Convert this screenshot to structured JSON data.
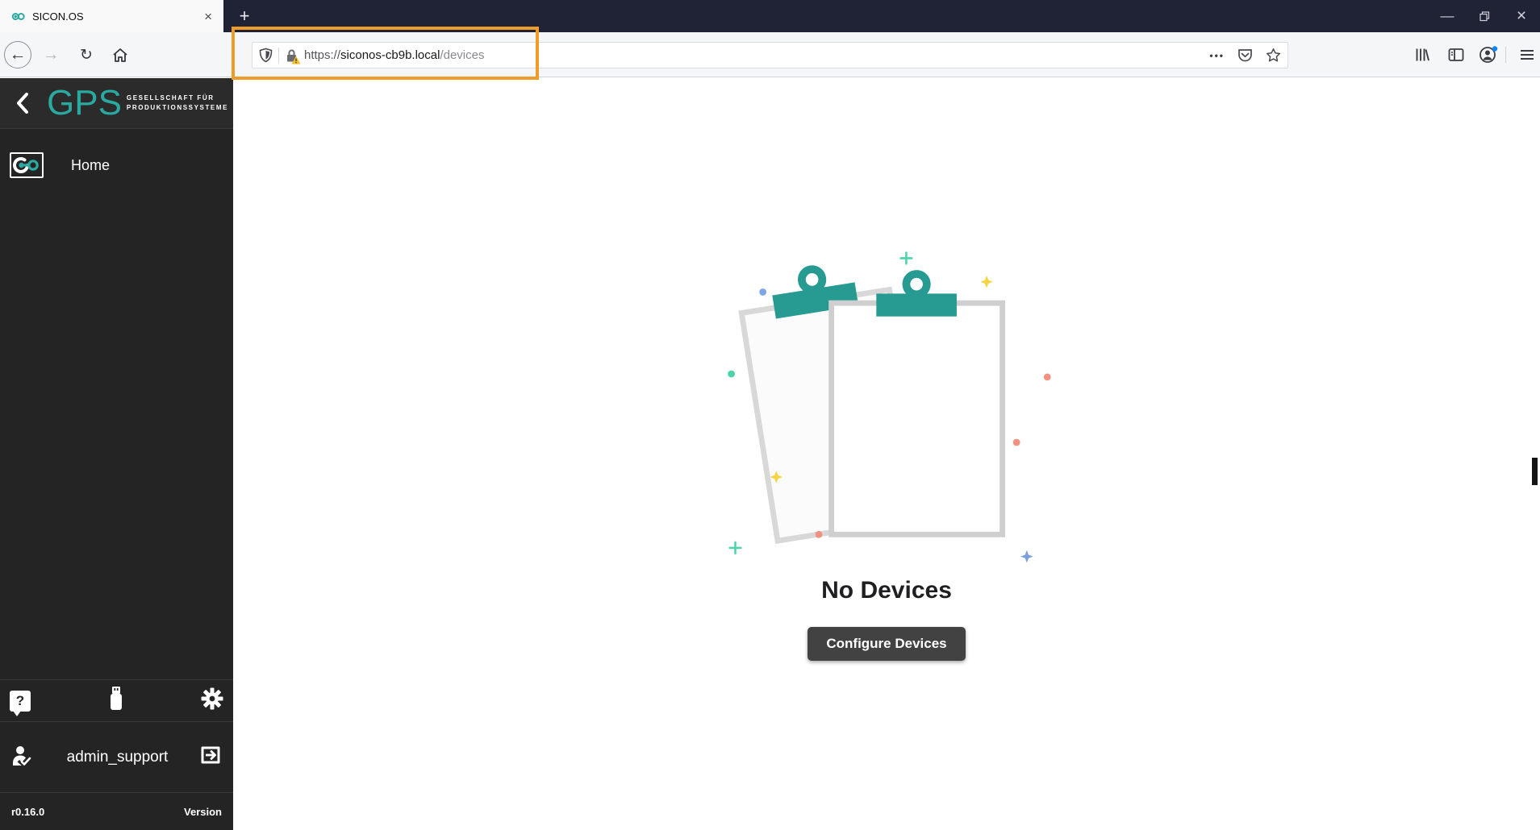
{
  "theme": {
    "teal": "#2aa9a0",
    "clip_teal": "#279b92",
    "orange": "#f09c28",
    "titlebar": "#1f2335",
    "sidebar_bg": "#242424",
    "button_bg": "#424242"
  },
  "browser": {
    "tab": {
      "title": "SICON.OS"
    },
    "urlbar": {
      "scheme": "https://",
      "host": "siconos-cb9b.local",
      "path": "/devices"
    }
  },
  "glyphs": {
    "new_tab": "+",
    "close_tab": "×",
    "minimize": "—",
    "close_window": "×",
    "back": "←",
    "forward": "→",
    "reload": "↻",
    "ellipsis": "•••",
    "question_mark": "?"
  },
  "sidebar": {
    "logo": {
      "text": "GPS",
      "tagline_line1": "GESELLSCHAFT FÜR",
      "tagline_line2": "PRODUKTIONSSYSTEME"
    },
    "nav": [
      {
        "label": "Home"
      }
    ],
    "user": {
      "name": "admin_support"
    },
    "version": {
      "value": "r0.16.0",
      "label": "Version"
    }
  },
  "main": {
    "empty_state": {
      "title": "No Devices",
      "button_label": "Configure Devices"
    }
  }
}
